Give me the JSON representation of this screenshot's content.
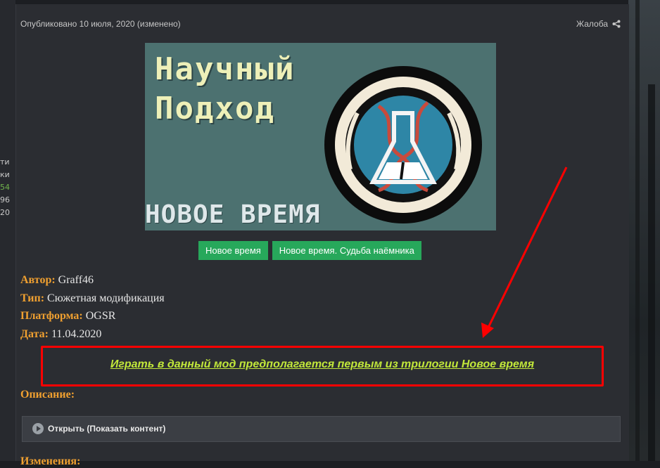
{
  "post": {
    "meta": "Опубликовано 10 июля, 2020 (изменено)",
    "report_label": "Жалоба",
    "share_icon": "share-icon"
  },
  "sidebar_fragments": [
    "ти",
    "ки",
    "54",
    "96",
    "20"
  ],
  "banner": {
    "title_line1": "Научный",
    "title_line2": "Подход",
    "subtitle": "НОВОЕ ВРЕМЯ"
  },
  "buttons": [
    "Новое время",
    "Новое время. Судьба наёмника"
  ],
  "fields": [
    {
      "label": "Автор:",
      "value": "Graff46"
    },
    {
      "label": "Тип:",
      "value": "Сюжетная модификация"
    },
    {
      "label": "Платформа:",
      "value": "OGSR"
    },
    {
      "label": "Дата:",
      "value": "11.04.2020"
    }
  ],
  "highlight": "Играть в данный мод предполагается первым из трилогии Новое время",
  "description_label": "Описание:",
  "spoiler_label": "Открыть (Показать контент)",
  "next_label": "Изменения:",
  "colors": {
    "label": "#f0a030",
    "button": "#27a85b",
    "highlight_text": "#c2e83a",
    "annotation": "#ff0000"
  }
}
